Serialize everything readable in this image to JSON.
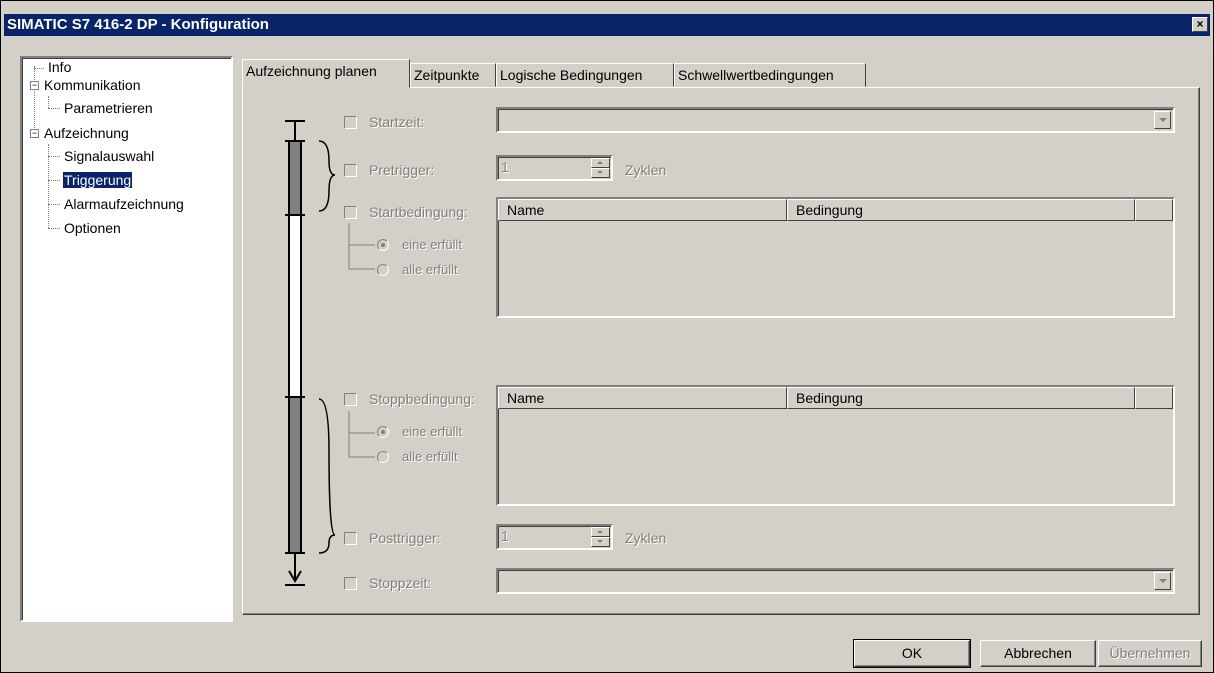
{
  "window": {
    "title": "SIMATIC S7 416-2 DP - Konfiguration",
    "close_glyph": "×"
  },
  "tree": {
    "items": [
      {
        "label": "Info"
      },
      {
        "label": "Kommunikation"
      },
      {
        "label": "Parametrieren"
      },
      {
        "label": "Aufzeichnung"
      },
      {
        "label": "Signalauswahl"
      },
      {
        "label": "Triggerung"
      },
      {
        "label": "Alarmaufzeichnung"
      },
      {
        "label": "Optionen"
      }
    ]
  },
  "tabs": [
    {
      "label": "Aufzeichnung planen"
    },
    {
      "label": "Zeitpunkte"
    },
    {
      "label": "Logische Bedingungen"
    },
    {
      "label": "Schwellwertbedingungen"
    }
  ],
  "form": {
    "startzeit": {
      "label": "Startzeit:",
      "value": ""
    },
    "pretrigger": {
      "label": "Pretrigger:",
      "value": "1",
      "unit": "Zyklen"
    },
    "startbedingung": {
      "label": "Startbedingung:",
      "radio_one": "eine erfüllt",
      "radio_all": "alle erfüllt",
      "columns": [
        "Name",
        "Bedingung"
      ]
    },
    "stoppbedingung": {
      "label": "Stoppbedingung:",
      "radio_one": "eine erfüllt",
      "radio_all": "alle erfüllt",
      "columns": [
        "Name",
        "Bedingung"
      ]
    },
    "posttrigger": {
      "label": "Posttrigger:",
      "value": "1",
      "unit": "Zyklen"
    },
    "stoppzeit": {
      "label": "Stoppzeit:",
      "value": ""
    }
  },
  "buttons": {
    "ok": "OK",
    "cancel": "Abbrechen",
    "apply": "Übernehmen"
  },
  "colors": {
    "titlebar": "#0a246a",
    "face": "#d4d0c8",
    "selection": "#0a246a"
  }
}
